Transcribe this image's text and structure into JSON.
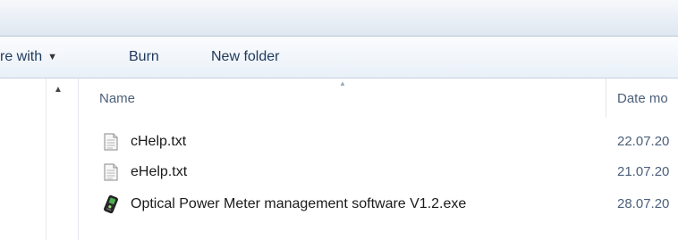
{
  "toolbar": {
    "share_label": "re with",
    "burn_label": "Burn",
    "new_folder_label": "New folder"
  },
  "columns": {
    "name": "Name",
    "date": "Date mo"
  },
  "files": [
    {
      "name": "cHelp.txt",
      "date": "22.07.20",
      "icon": "text-file-icon"
    },
    {
      "name": "eHelp.txt",
      "date": "21.07.20",
      "icon": "text-file-icon"
    },
    {
      "name": "Optical Power Meter management software V1.2.exe",
      "date": "28.07.20",
      "icon": "application-icon"
    }
  ],
  "colors": {
    "toolbar_text": "#1e395b",
    "header_text": "#4c607a",
    "file_text": "#1a1a1a"
  }
}
